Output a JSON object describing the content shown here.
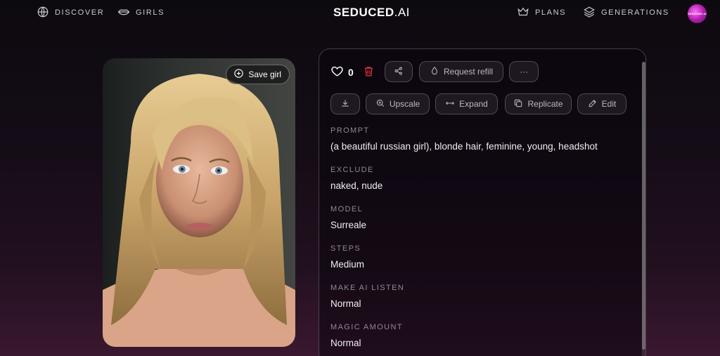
{
  "nav": {
    "discover": "DISCOVER",
    "girls": "GIRLS",
    "brand_main": "SEDUCED",
    "brand_ai": ".AI",
    "plans": "PLANS",
    "generations": "GENERATIONS",
    "avatar_text": "SEDUCED.AI"
  },
  "image": {
    "save_label": "Save girl"
  },
  "actions": {
    "like_count": "0",
    "request_refill": "Request refill",
    "more": "···",
    "upscale": "Upscale",
    "expand": "Expand",
    "replicate": "Replicate",
    "edit": "Edit"
  },
  "details": [
    {
      "label": "PROMPT",
      "value": "(a beautiful russian girl), blonde hair, feminine, young, headshot"
    },
    {
      "label": "EXCLUDE",
      "value": "naked, nude"
    },
    {
      "label": "MODEL",
      "value": "Surreale"
    },
    {
      "label": "STEPS",
      "value": "Medium"
    },
    {
      "label": "MAKE AI LISTEN",
      "value": "Normal"
    },
    {
      "label": "MAGIC AMOUNT",
      "value": "Normal"
    }
  ],
  "colors": {
    "accent": "#b21fae",
    "delete": "#e0323a"
  },
  "icons": [
    "globe-icon",
    "lips-icon",
    "crown-icon",
    "layers-icon",
    "plus-circle-icon",
    "heart-icon",
    "trash-icon",
    "share-icon",
    "drop-icon",
    "download-icon",
    "zoom-in-icon",
    "expand-arrows-icon",
    "copy-icon",
    "edit-icon"
  ]
}
